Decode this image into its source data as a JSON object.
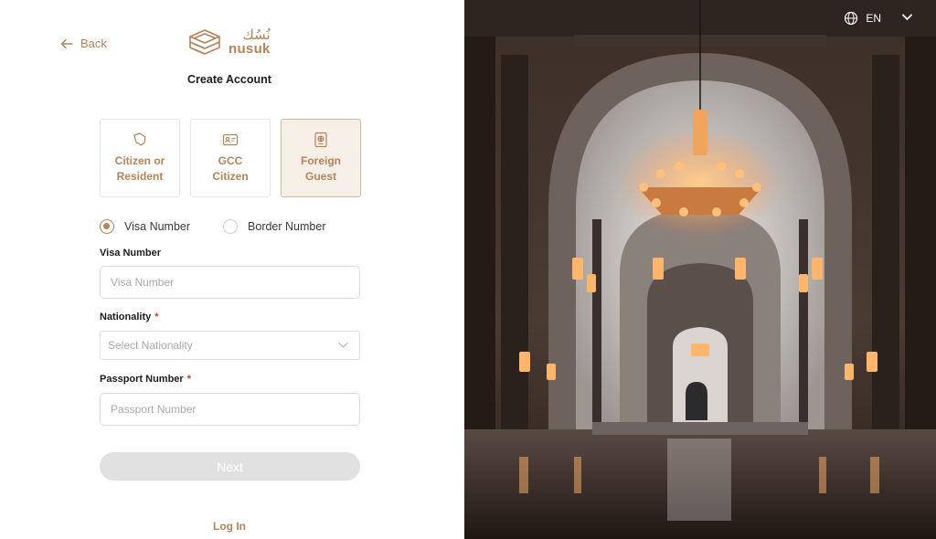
{
  "nav": {
    "back_label": "Back"
  },
  "logo": {
    "arabic": "نُسُك",
    "english": "nusuk"
  },
  "page": {
    "title": "Create Account"
  },
  "account_types": [
    {
      "label": "Citizen or\nResident",
      "icon": "map-pin-icon",
      "active": false
    },
    {
      "label": "GCC\nCitizen",
      "icon": "id-card-icon",
      "active": false
    },
    {
      "label": "Foreign\nGuest",
      "icon": "passport-icon",
      "active": true
    }
  ],
  "id_type": {
    "options": [
      "Visa Number",
      "Border Number"
    ],
    "selected": "Visa Number"
  },
  "form": {
    "visa": {
      "label": "Visa Number",
      "placeholder": "Visa Number",
      "value": ""
    },
    "nationality": {
      "label": "Nationality",
      "required_mark": "*",
      "placeholder": "Select Nationality"
    },
    "passport": {
      "label": "Passport Number",
      "required_mark": "*",
      "placeholder": "Passport Number",
      "value": ""
    },
    "next_label": "Next"
  },
  "footer": {
    "login_label": "Log In"
  },
  "language": {
    "code": "EN",
    "icon": "globe-icon"
  },
  "colors": {
    "accent": "#b3835a",
    "active_card_bg": "#f6efe8",
    "disabled_button": "#e1e1e1",
    "required": "#c0392b"
  }
}
